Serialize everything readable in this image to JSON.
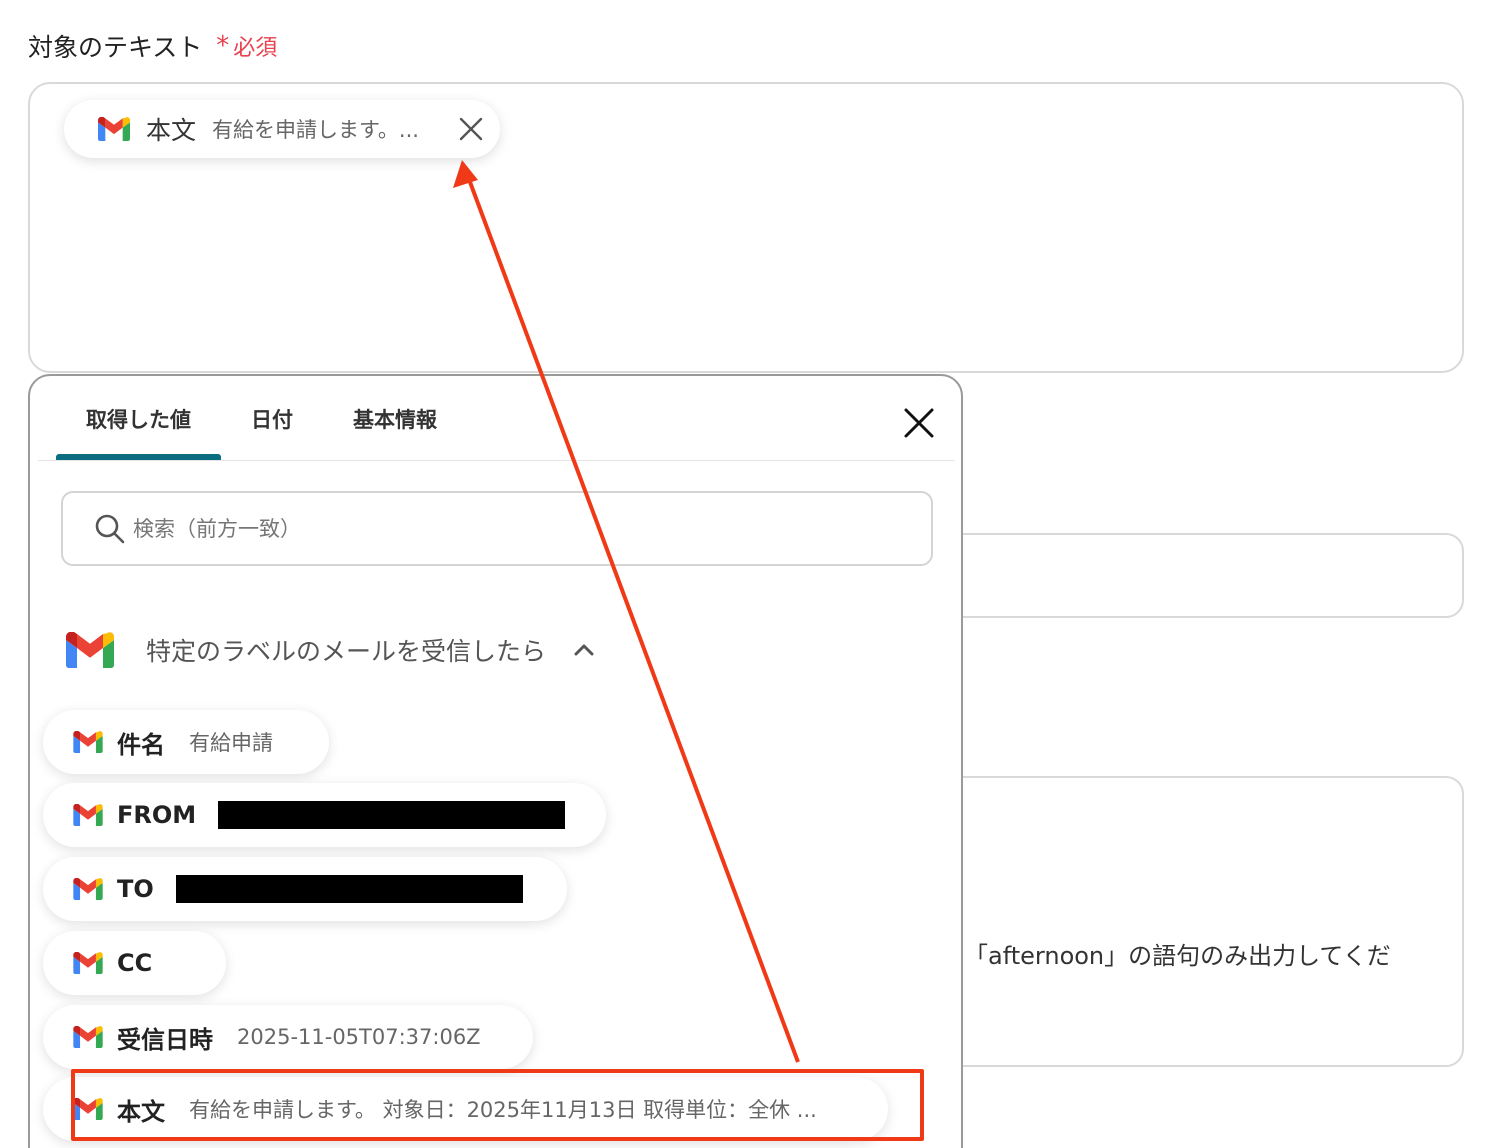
{
  "field": {
    "label": "対象のテキスト",
    "required_mark": "*",
    "required_text": "必須"
  },
  "selected_chip": {
    "key": "本文",
    "value": "有給を申請します。..."
  },
  "background": {
    "instruction_snippet": "「afternoon」の語句のみ出力してくだ"
  },
  "popup": {
    "tabs": [
      {
        "label": "取得した値",
        "active": true
      },
      {
        "label": "日付",
        "active": false
      },
      {
        "label": "基本情報",
        "active": false
      }
    ],
    "search_placeholder": "検索（前方一致）",
    "group_title": "特定のラベルのメールを受信したら",
    "items": [
      {
        "key": "件名",
        "value": "有給申請"
      },
      {
        "key": "FROM",
        "value": ""
      },
      {
        "key": "TO",
        "value": ""
      },
      {
        "key": "CC",
        "value": ""
      },
      {
        "key": "受信日時",
        "value": "2025-11-05T07:37:06Z"
      },
      {
        "key": "本文",
        "value": "有給を申請します。 対象日：2025年11月13日 取得単位：全休 ..."
      }
    ]
  },
  "colors": {
    "accent_tab": "#0b6e80",
    "required": "#e8424f",
    "annotation": "#f03a17",
    "gmail_red": "#EA4335",
    "gmail_blue": "#4285F4",
    "gmail_green": "#34A853",
    "gmail_yellow": "#FBBC04"
  },
  "icons": [
    "gmail-icon",
    "close-icon",
    "search-icon",
    "chevron-up-icon"
  ]
}
